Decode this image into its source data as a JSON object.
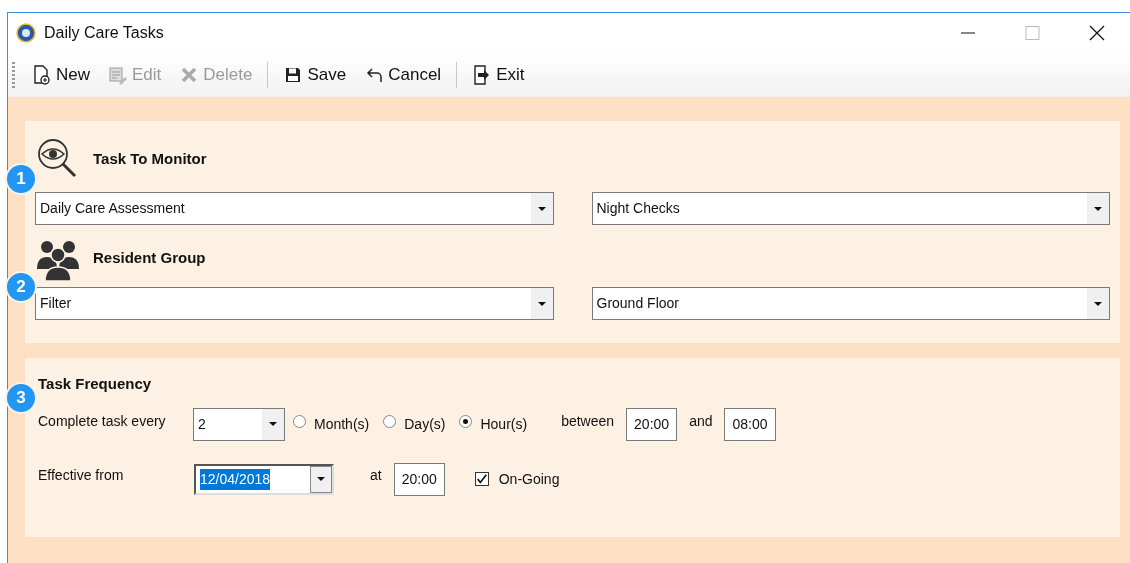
{
  "window": {
    "title": "Daily Care Tasks"
  },
  "toolbar": [
    [
      {
        "kind": "new",
        "label": "New",
        "disabled": false
      },
      {
        "kind": "edit",
        "label": "Edit",
        "disabled": true
      },
      {
        "kind": "delete",
        "label": "Delete",
        "disabled": true
      }
    ],
    [
      {
        "kind": "save",
        "label": "Save",
        "disabled": false
      },
      {
        "kind": "cancel",
        "label": "Cancel",
        "disabled": false
      }
    ],
    [
      {
        "kind": "exit",
        "label": "Exit",
        "disabled": false
      }
    ]
  ],
  "selection_panel": [
    {
      "kind": "task",
      "step": "1",
      "title": "Task To Monitor",
      "dropdowns": [
        "Daily Care Assessment",
        "Night Checks"
      ]
    },
    {
      "kind": "group",
      "step": "2",
      "title": "Resident Group",
      "dropdowns": [
        "Filter",
        "Ground Floor"
      ]
    }
  ],
  "frequency": {
    "step": "3",
    "title": "Task Frequency",
    "every_label": "Complete task every",
    "every_value": "2",
    "units": [
      {
        "label": "Month(s)",
        "selected": false
      },
      {
        "label": "Day(s)",
        "selected": false
      },
      {
        "label": "Hour(s)",
        "selected": true
      }
    ],
    "between_label": "between",
    "between_from": "20:00",
    "and_label": "and",
    "between_to": "08:00",
    "effective_label": "Effective from",
    "effective_date": "12/04/2018",
    "effective_date_highlighted": true,
    "at_label": "at",
    "at_value": "20:00",
    "ongoing": {
      "label": "On-Going",
      "checked": true
    }
  }
}
